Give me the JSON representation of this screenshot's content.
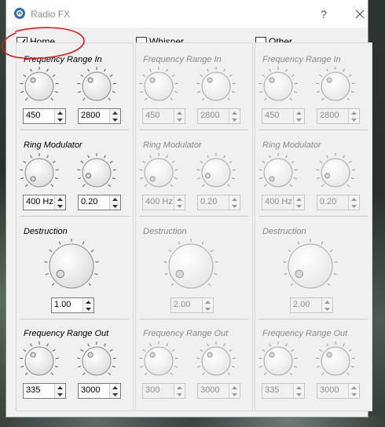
{
  "window": {
    "title": "Radio FX",
    "help_label": "?"
  },
  "panels": [
    {
      "name": "Home",
      "checked": true,
      "enabled": true,
      "freq_in": {
        "title": "Frequency Range In",
        "low": "450",
        "high": "2800"
      },
      "ring": {
        "title": "Ring Modulator",
        "freq": "400 Hz",
        "mix": "0.20"
      },
      "destruction": {
        "title": "Destruction",
        "value": "1.00"
      },
      "freq_out": {
        "title": "Frequency Range Out",
        "low": "335",
        "high": "3000"
      }
    },
    {
      "name": "Whisper",
      "checked": false,
      "enabled": false,
      "freq_in": {
        "title": "Frequency Range In",
        "low": "450",
        "high": "2800"
      },
      "ring": {
        "title": "Ring Modulator",
        "freq": "400 Hz",
        "mix": "0.20"
      },
      "destruction": {
        "title": "Destruction",
        "value": "2.00"
      },
      "freq_out": {
        "title": "Frequency Range Out",
        "low": "300",
        "high": "3000"
      }
    },
    {
      "name": "Other",
      "checked": false,
      "enabled": false,
      "freq_in": {
        "title": "Frequency Range In",
        "low": "450",
        "high": "2800"
      },
      "ring": {
        "title": "Ring Modulator",
        "freq": "400 Hz",
        "mix": "0.20"
      },
      "destruction": {
        "title": "Destruction",
        "value": "2.00"
      },
      "freq_out": {
        "title": "Frequency Range Out",
        "low": "335",
        "high": "3000"
      }
    }
  ],
  "icons": {
    "app": "radio-fx-app-icon",
    "help": "help-icon",
    "close": "close-icon",
    "check": "checkmark-icon"
  },
  "colors": {
    "annotation": "#e0191b",
    "disabled_text": "#8a8a8a"
  }
}
